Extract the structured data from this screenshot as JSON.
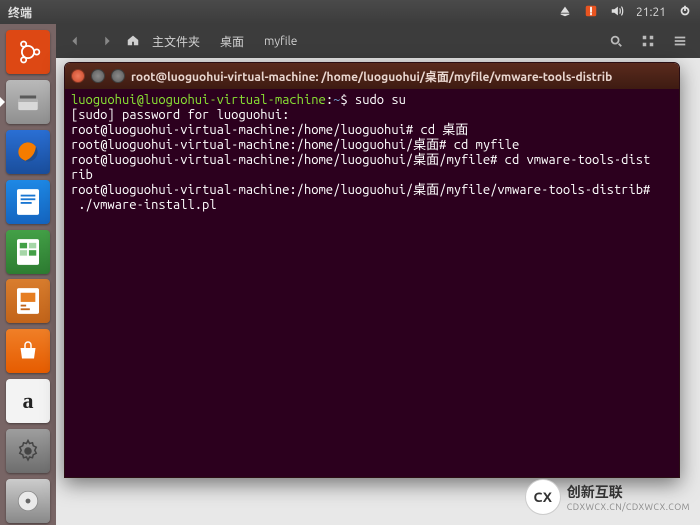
{
  "menubar": {
    "title": "终端",
    "clock": "21:21"
  },
  "nautilus": {
    "home_label": "主文件夹",
    "crumb2": "桌面",
    "crumb3": "myfile"
  },
  "launcher": {
    "items": [
      {
        "name": "dash"
      },
      {
        "name": "files"
      },
      {
        "name": "firefox"
      },
      {
        "name": "writer"
      },
      {
        "name": "calc"
      },
      {
        "name": "impress"
      },
      {
        "name": "software"
      },
      {
        "name": "amazon"
      },
      {
        "name": "settings"
      },
      {
        "name": "dvd"
      }
    ]
  },
  "terminal": {
    "title": "root@luoguohui-virtual-machine: /home/luoguohui/桌面/myfile/vmware-tools-distrib",
    "lines": [
      {
        "prompt_user": "luoguohui@luoguohui-virtual-machine",
        "prompt_path": "~",
        "sep": "$",
        "cmd": "sudo su"
      },
      {
        "plain": "[sudo] password for luoguohui:"
      },
      {
        "root": "root@luoguohui-virtual-machine:/home/luoguohui#",
        "cmd": "cd 桌面"
      },
      {
        "root": "root@luoguohui-virtual-machine:/home/luoguohui/桌面#",
        "cmd": "cd myfile"
      },
      {
        "root": "root@luoguohui-virtual-machine:/home/luoguohui/桌面/myfile#",
        "cmd": "cd vmware-tools-distrib"
      },
      {
        "root": "root@luoguohui-virtual-machine:/home/luoguohui/桌面/myfile/vmware-tools-distrib#",
        "cmd": " ./vmware-install.pl"
      }
    ],
    "wrap_tail": "rib"
  },
  "brand": {
    "logo": "CX",
    "name": "创新互联",
    "url": "CDXWCX.CN/CDXWCX.COM"
  }
}
